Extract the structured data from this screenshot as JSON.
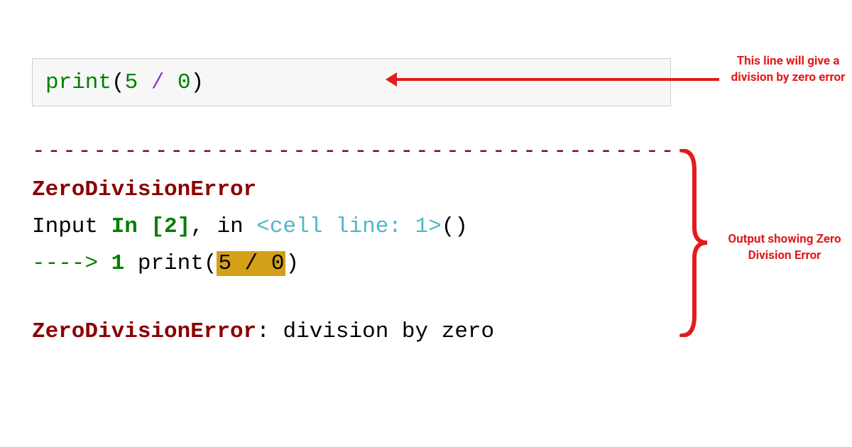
{
  "code_cell": {
    "fn": "print",
    "lparen": "(",
    "num1": "5",
    "op": " / ",
    "num2": "0",
    "rparen": ")"
  },
  "annotation_1": "This line will give a division by zero error",
  "traceback": {
    "dashes": "--------------------------------------------",
    "error_name": "ZeroDivisionError",
    "input_prefix": "Input ",
    "input_in": "In [2]",
    "input_comma": ", ",
    "input_in2": "in ",
    "cell_line": "<cell line: 1>",
    "parens": "()",
    "arrow": "----> ",
    "lineno": "1",
    "print_call": " print(",
    "highlighted": "5 / 0",
    "close_paren": ")",
    "final_err": "ZeroDivisionError",
    "final_colon": ": ",
    "final_msg": "division by zero"
  },
  "annotation_2": "Output showing Zero Division Error"
}
